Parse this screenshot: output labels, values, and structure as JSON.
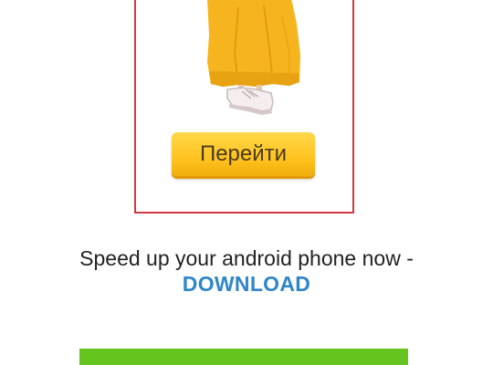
{
  "ad": {
    "button_label": "Перейти",
    "colors": {
      "frame_border": "#d0393f",
      "dress": "#f6b51e",
      "button": "#ffc31f"
    }
  },
  "promo": {
    "text": "Speed up your android phone now -",
    "link_label": "DOWNLOAD",
    "link_color": "#2f86c8"
  },
  "bottom_bar": {
    "color": "#66c41f"
  }
}
